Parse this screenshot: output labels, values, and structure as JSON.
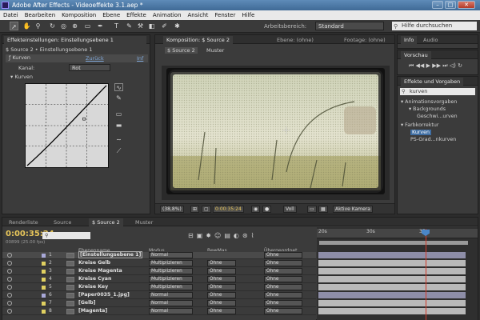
{
  "window": {
    "title": "Adobe After Effects - Videoeffekte 3.1.aep *"
  },
  "menu": [
    "Datei",
    "Bearbeiten",
    "Komposition",
    "Ebene",
    "Effekte",
    "Animation",
    "Ansicht",
    "Fenster",
    "Hilfe"
  ],
  "toolbar": {
    "workspace_label": "Arbeitsbereich:",
    "workspace_value": "Standard",
    "help_placeholder": "Hilfe durchsuchen"
  },
  "effect_controls": {
    "tab": "Effekteinstellungen: Einstellungsebene 1",
    "breadcrumb": "$ Source 2 • Einstellungsebene 1",
    "effect_name": "Kurven",
    "reset_link": "Zurück",
    "about_link": "Inf",
    "channel_label": "Kanal:",
    "channel_value": "Rot",
    "curves_label": "Kurven"
  },
  "composition": {
    "tab": "Komposition: $ Source 2",
    "tab2": "Ebene: (ohne)",
    "tab3": "Footage: (ohne)",
    "subtab": "$ Source 2",
    "subtab2": "Muster",
    "zoom": "(38,8%)",
    "time": "0:00:35:24",
    "resolution": "Voll",
    "camera": "Aktive Kamera"
  },
  "info_panel": {
    "tab1": "Info",
    "tab2": "Audio"
  },
  "preview_panel": {
    "title": "Vorschau"
  },
  "effects_panel": {
    "title": "Effekte und Vorgaben",
    "search": "kurven",
    "tree": [
      "▾ Animationsvorgaben",
      "▾ Backgrounds",
      "Geschwi...urven",
      "▾ Farbkorrektur",
      "Kurven",
      "PS-Grad...nkurven"
    ]
  },
  "timeline": {
    "tabs": [
      "Renderliste",
      "Source",
      "$ Source 2",
      "Muster"
    ],
    "timecode": "0:00:35:24",
    "frame_info": "00899 (25.00 fps)",
    "search_placeholder": "",
    "col_name": "Ebenenname",
    "col_mode": "Modus",
    "col_trkmat": "BewMas",
    "col_parent": "Übergeordnet",
    "ruler": [
      "20s",
      "30s",
      "35s"
    ],
    "layers": [
      {
        "num": "1",
        "name": "[Einstellungsebene 1]",
        "mode": "Normal",
        "trk": "",
        "parent": "Ohne",
        "color": "#a8a8d8"
      },
      {
        "num": "2",
        "name": "Kreise Gelb",
        "mode": "Multiplizieren",
        "trk": "Ohne",
        "parent": "Ohne",
        "color": "#e0d060"
      },
      {
        "num": "3",
        "name": "Kreise Magenta",
        "mode": "Multiplizieren",
        "trk": "Ohne",
        "parent": "Ohne",
        "color": "#e0d060"
      },
      {
        "num": "4",
        "name": "Kreise Cyan",
        "mode": "Multiplizieren",
        "trk": "Ohne",
        "parent": "Ohne",
        "color": "#e0d060"
      },
      {
        "num": "5",
        "name": "Kreise Key",
        "mode": "Multiplizieren",
        "trk": "Ohne",
        "parent": "Ohne",
        "color": "#e0d060"
      },
      {
        "num": "6",
        "name": "[Paper0035_1.jpg]",
        "mode": "Normal",
        "trk": "Ohne",
        "parent": "Ohne",
        "color": "#a8a8d8"
      },
      {
        "num": "7",
        "name": "[Gelb]",
        "mode": "Normal",
        "trk": "Ohne",
        "parent": "Ohne",
        "color": "#e0d060"
      },
      {
        "num": "8",
        "name": "[Magenta]",
        "mode": "Normal",
        "trk": "Ohne",
        "parent": "Ohne",
        "color": "#e0d060"
      }
    ]
  }
}
